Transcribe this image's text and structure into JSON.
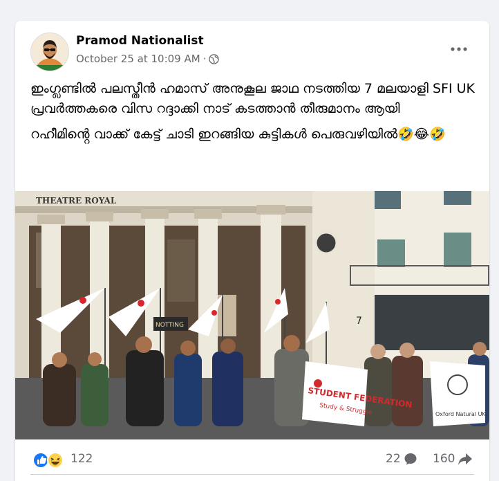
{
  "post": {
    "author": "Pramod Nationalist",
    "timestamp": "October 25 at 10:09 AM",
    "separator": "·",
    "privacy_icon": "globe-icon",
    "more_icon": "more-horizontal-icon",
    "text_lines": [
      "ഇംഗ്ലണ്ടിൽ പലസ്തീൻ ഹമാസ്  അനുകൂല ജാഥ നടത്തിയ 7 മലയാളി SFI UK പ്രവർത്തകരെ വിസ റദ്ദാക്കി നാട് കടത്താൻ തീരുമാനം ആയി",
      "റഹീമിൻ്റെ വാക്ക് കേട്ട് ചാടി ഇറങ്ങിയ കുട്ടികൾ പെരുവഴിയിൽ🤣😂🤣"
    ]
  },
  "photo": {
    "theatre_sign": "THEATRE ROYAL",
    "door_number": "7",
    "sign": "NOTTING",
    "banner_main": "STUDENT FEDERATION",
    "banner_sub": "Study & Struggle",
    "banner_right": "Oxford Natural UK"
  },
  "engagement": {
    "reactions_icons": [
      "like-icon",
      "haha-icon"
    ],
    "reactions_count": "122",
    "comments_count": "22",
    "comment_icon": "comment-icon",
    "shares_count": "160",
    "share_icon": "share-icon"
  },
  "colors": {
    "accent": "#1877f2",
    "muted_text": "#65676b",
    "background": "#f0f2f5"
  }
}
